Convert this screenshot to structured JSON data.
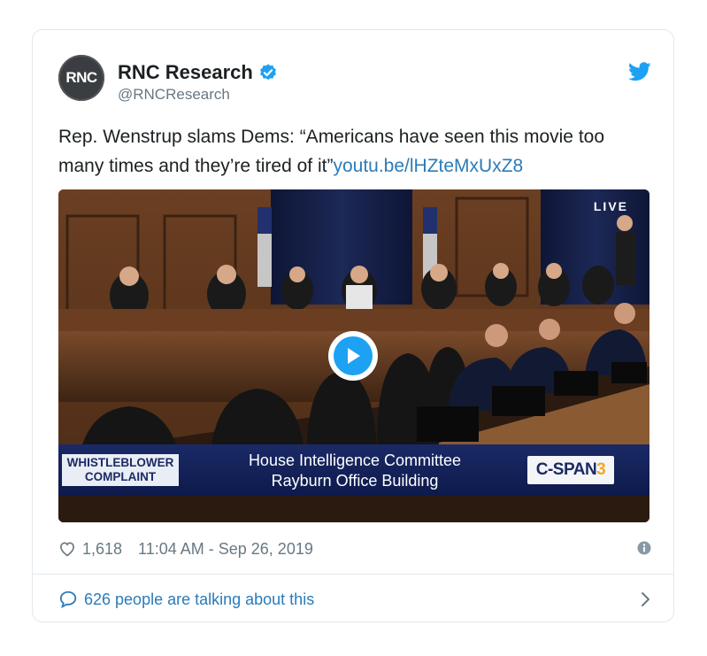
{
  "account": {
    "avatar_text": "RNC",
    "display_name": "RNC Research",
    "handle": "@RNCResearch",
    "verified": true
  },
  "tweet": {
    "text": "Rep. Wenstrup slams Dems: “Americans have seen this movie too many times and they’re tired of it”",
    "link": "youtu.be/lHZteMxUxZ8"
  },
  "media": {
    "live_label": "LIVE",
    "lower_third_left": [
      "WHISTLEBLOWER",
      "COMPLAINT"
    ],
    "lower_third_center": [
      "House Intelligence Committee",
      "Rayburn Office Building"
    ],
    "network_logo": "C-SPAN3"
  },
  "meta": {
    "likes": "1,618",
    "timestamp": "11:04 AM - Sep 26, 2019"
  },
  "footer": {
    "conversation_text": "626 people are talking about this"
  },
  "colors": {
    "link_blue": "#2b7bb9",
    "twitter_blue": "#1da1f2",
    "muted_gray": "#697882"
  },
  "icons": [
    "verified-badge-icon",
    "twitter-bird-icon",
    "play-icon",
    "heart-icon",
    "info-icon",
    "speech-bubble-icon",
    "chevron-right-icon"
  ]
}
